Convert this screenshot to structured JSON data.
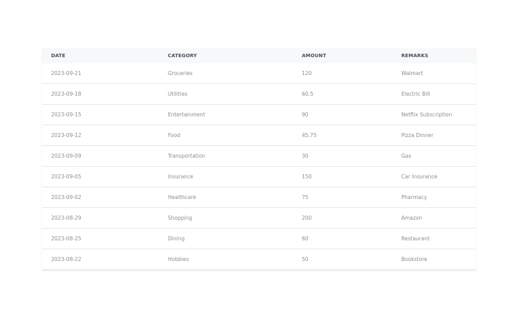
{
  "table": {
    "headers": [
      "DATE",
      "CATEGORY",
      "AMOUNT",
      "REMARKS"
    ],
    "rows": [
      [
        "2023-09-21",
        "Groceries",
        "120",
        "Walmart"
      ],
      [
        "2023-09-18",
        "Utilities",
        "60.5",
        "Electric Bill"
      ],
      [
        "2023-09-15",
        "Entertainment",
        "90",
        "Netflix Subscription"
      ],
      [
        "2023-09-12",
        "Food",
        "45.75",
        "Pizza Dinner"
      ],
      [
        "2023-09-09",
        "Transportation",
        "30",
        "Gas"
      ],
      [
        "2023-09-05",
        "Insurance",
        "150",
        "Car Insurance"
      ],
      [
        "2023-09-02",
        "Healthcare",
        "75",
        "Pharmacy"
      ],
      [
        "2023-08-29",
        "Shopping",
        "200",
        "Amazon"
      ],
      [
        "2023-08-25",
        "Dining",
        "60",
        "Restaurant"
      ],
      [
        "2023-08-22",
        "Hobbies",
        "50",
        "Bookstore"
      ]
    ]
  },
  "colors": {
    "header_bg": "#f7f8fa",
    "header_text": "#4b4f58",
    "cell_text": "#8a8d93",
    "divider": "#e5e7eb"
  }
}
